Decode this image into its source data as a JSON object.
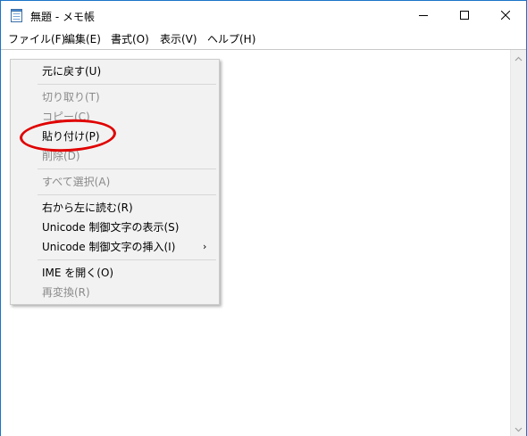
{
  "window": {
    "title": "無題 - メモ帳",
    "icons": {
      "app": "notepad-icon",
      "minimize": "minimize-icon",
      "maximize": "maximize-icon",
      "close": "close-icon"
    }
  },
  "menubar": {
    "items": [
      "ファイル(F)",
      "編集(E)",
      "書式(O)",
      "表示(V)",
      "ヘルプ(H)"
    ]
  },
  "context_menu": {
    "items": [
      {
        "label": "元に戻す(U)",
        "enabled": true
      },
      {
        "label": "切り取り(T)",
        "enabled": false
      },
      {
        "label": "コピー(C)",
        "enabled": false
      },
      {
        "label": "貼り付け(P)",
        "enabled": true,
        "highlighted": true
      },
      {
        "label": "削除(D)",
        "enabled": false
      },
      {
        "label": "すべて選択(A)",
        "enabled": false
      },
      {
        "label": "右から左に読む(R)",
        "enabled": true
      },
      {
        "label": "Unicode 制御文字の表示(S)",
        "enabled": true
      },
      {
        "label": "Unicode 制御文字の挿入(I)",
        "enabled": true,
        "submenu": true
      },
      {
        "label": "IME を開く(O)",
        "enabled": true
      },
      {
        "label": "再変換(R)",
        "enabled": false
      }
    ]
  },
  "annotation": {
    "color": "#e00000",
    "target": "貼り付け(P)"
  },
  "colors": {
    "window_border": "#1a73c8",
    "menu_bg": "#f2f2f2",
    "disabled_text": "#8a8a8a"
  }
}
